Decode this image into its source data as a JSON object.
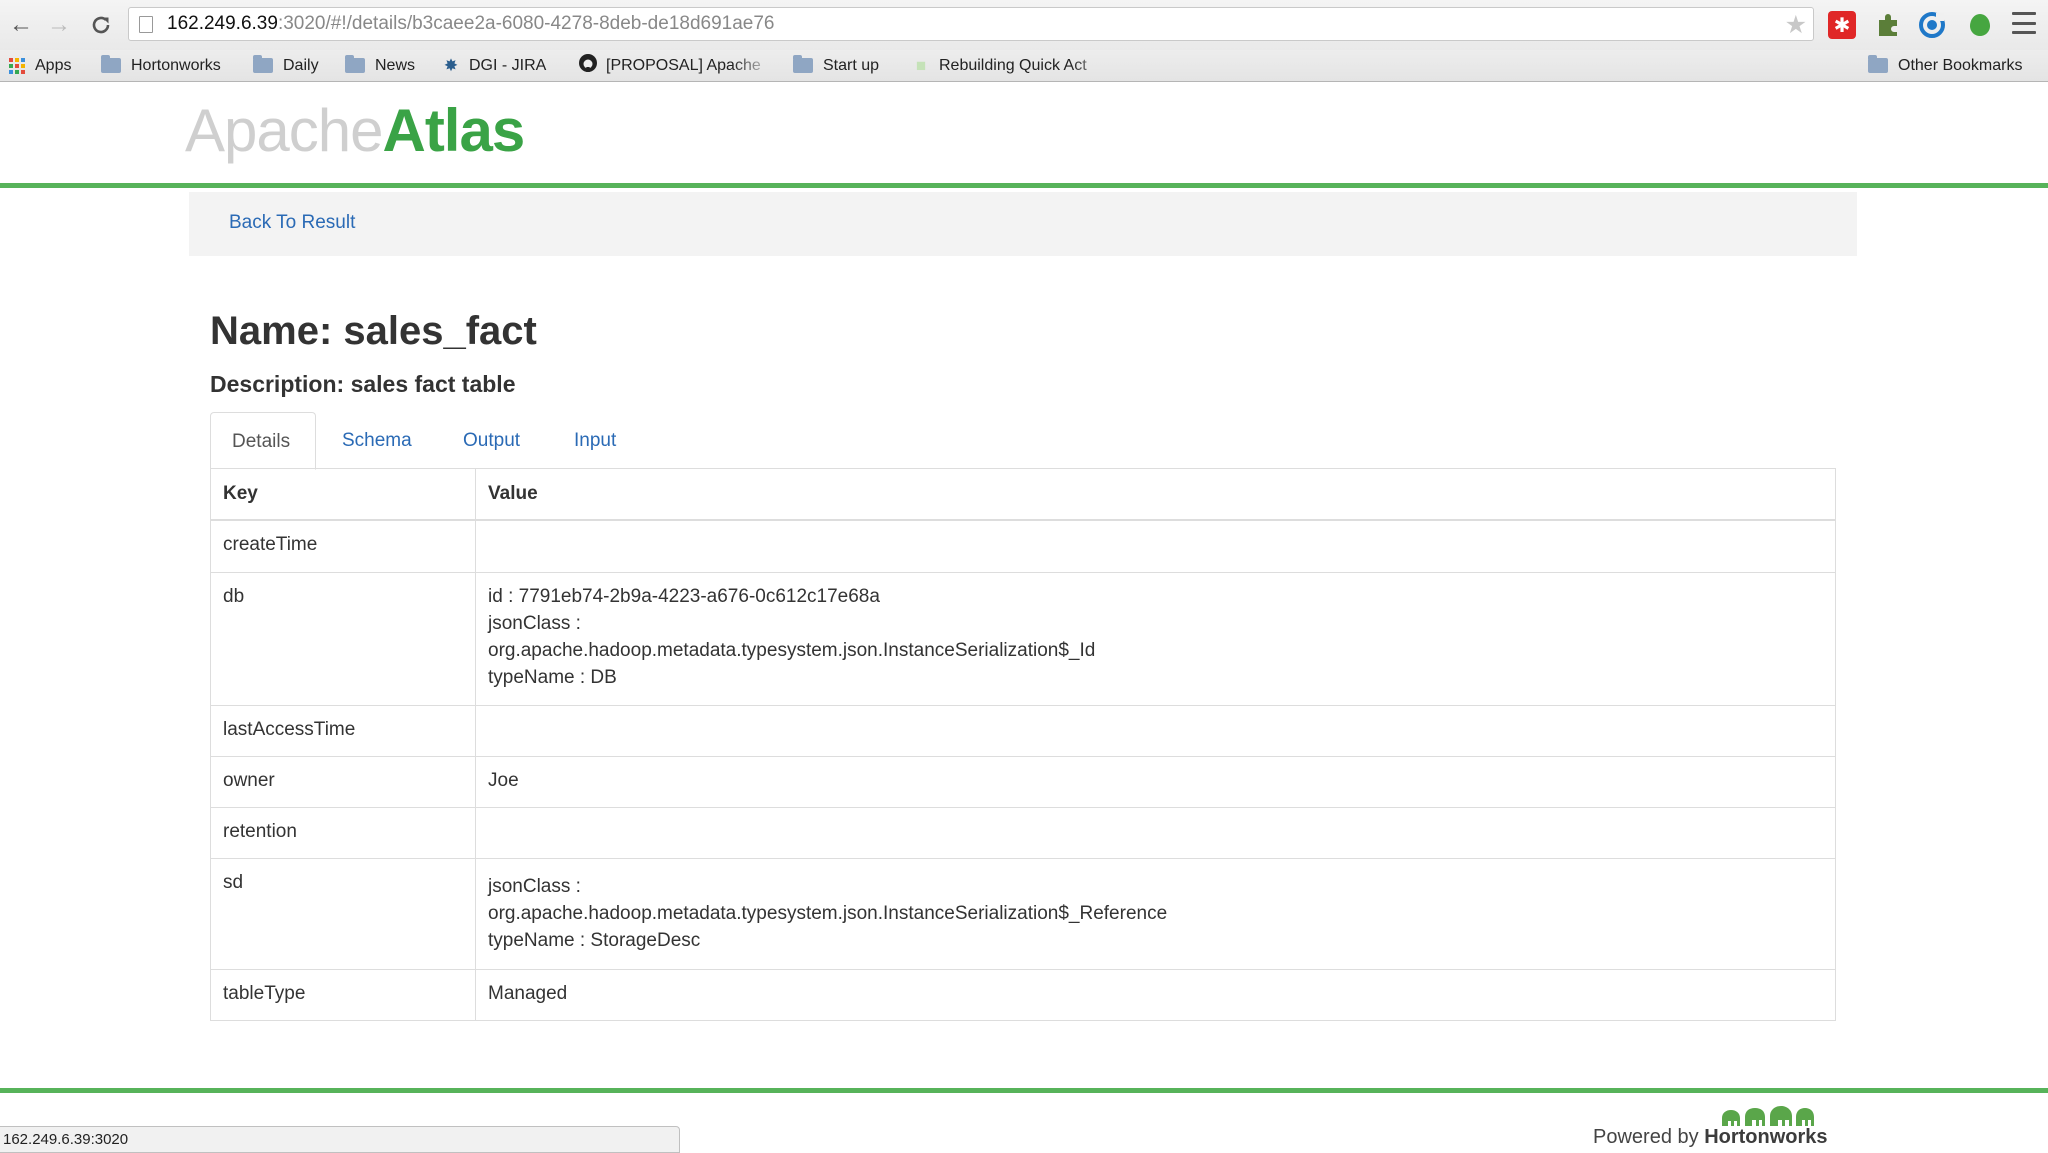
{
  "browser": {
    "url_host": "162.249.6.39",
    "url_rest": ":3020/#!/details/b3caee2a-6080-4278-8deb-de18d691ae76",
    "bookmarks": [
      {
        "label": "Apps"
      },
      {
        "label": "Hortonworks"
      },
      {
        "label": "Daily"
      },
      {
        "label": "News"
      },
      {
        "label": "DGI - JIRA"
      },
      {
        "label": "[PROPOSAL] Apache"
      },
      {
        "label": "Start up"
      },
      {
        "label": "Rebuilding Quick Act"
      },
      {
        "label": "Other Bookmarks"
      }
    ],
    "status_text": "162.249.6.39:3020"
  },
  "app": {
    "logo_light": "Apache",
    "logo_bold": "Atlas",
    "back_link": "Back To Result",
    "brand_green": "#3aa346"
  },
  "entity": {
    "name_line": "Name: sales_fact",
    "description_line": "Description: sales fact table"
  },
  "tabs": [
    {
      "label": "Details",
      "active": true
    },
    {
      "label": "Schema"
    },
    {
      "label": "Output"
    },
    {
      "label": "Input"
    }
  ],
  "table": {
    "headers": [
      "Key",
      "Value"
    ],
    "rows": [
      {
        "key": "createTime",
        "lines": []
      },
      {
        "key": "db",
        "lines": [
          "id : 7791eb74-2b9a-4223-a676-0c612c17e68a",
          "jsonClass :",
          "org.apache.hadoop.metadata.typesystem.json.InstanceSerialization$_Id",
          "typeName : DB"
        ]
      },
      {
        "key": "lastAccessTime",
        "lines": []
      },
      {
        "key": "owner",
        "lines": [
          "Joe"
        ]
      },
      {
        "key": "retention",
        "lines": []
      },
      {
        "key": "sd",
        "lines": [
          "jsonClass :",
          "org.apache.hadoop.metadata.typesystem.json.InstanceSerialization$_Reference",
          "typeName : StorageDesc"
        ]
      },
      {
        "key": "tableType",
        "lines": [
          "Managed"
        ]
      }
    ]
  },
  "footer": {
    "powered_by": "Powered by",
    "brand": "Hortonworks"
  }
}
